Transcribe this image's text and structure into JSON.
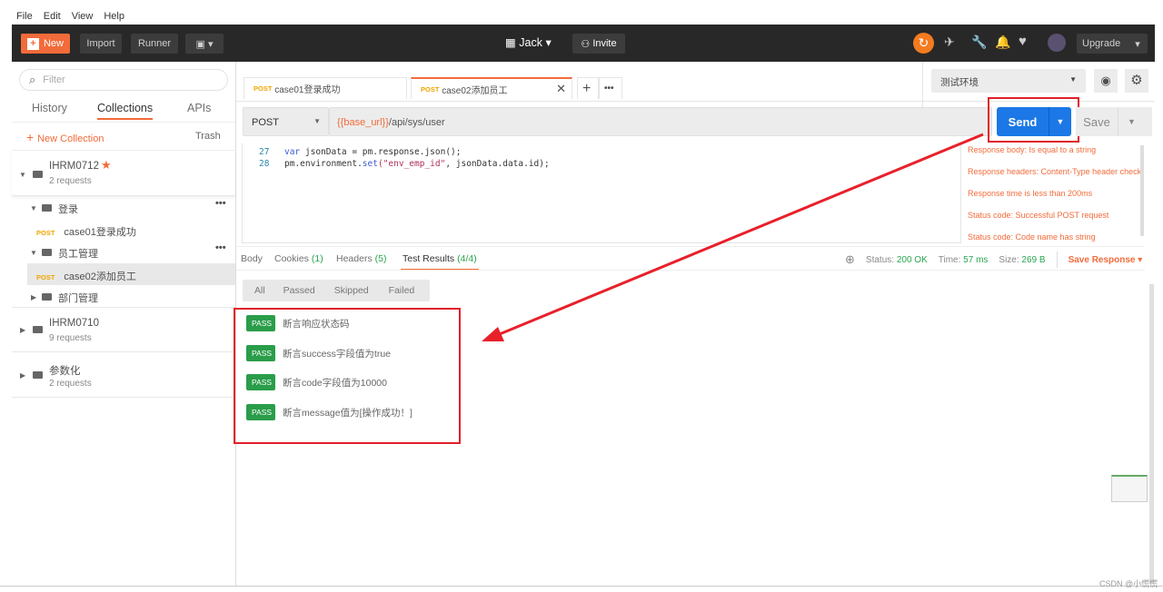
{
  "menu": [
    "File",
    "Edit",
    "View",
    "Help"
  ],
  "topbar": {
    "new": "New",
    "import": "Import",
    "runner": "Runner",
    "workspace": "Jack",
    "invite": "Invite",
    "upgrade": "Upgrade"
  },
  "sidebar": {
    "filter_placeholder": "Filter",
    "tabs": [
      "History",
      "Collections",
      "APIs"
    ],
    "new_collection": "New Collection",
    "trash": "Trash",
    "collections": [
      {
        "name": "IHRM0712",
        "sub": "2 requests",
        "starred": true
      },
      {
        "name": "IHRM0710",
        "sub": "9 requests"
      },
      {
        "name": "参数化",
        "sub": "2 requests"
      }
    ],
    "folders": [
      {
        "name": "登录",
        "requests": [
          {
            "method": "POST",
            "name": "case01登录成功"
          }
        ]
      },
      {
        "name": "员工管理",
        "requests": [
          {
            "method": "POST",
            "name": "case02添加员工"
          }
        ]
      },
      {
        "name": "部门管理"
      }
    ]
  },
  "tabs": [
    {
      "method": "POST",
      "name": "case01登录成功"
    },
    {
      "method": "POST",
      "name": "case02添加员工"
    }
  ],
  "environment": "测试环境",
  "request": {
    "method": "POST",
    "url_var": "{{base_url}}",
    "url_path": "/api/sys/user",
    "send": "Send",
    "save": "Save"
  },
  "code": [
    {
      "line": "27",
      "kw": "var",
      "text": " jsonData = pm.response.json();"
    },
    {
      "line": "28",
      "pre": "pm.environment.",
      "kw": "set",
      "str": "(\"env_emp_id\"",
      "text": ", jsonData.data.id);"
    }
  ],
  "snippets": [
    "Response body: Is equal to a string",
    "Response headers: Content-Type header check",
    "Response time is less than 200ms",
    "Status code: Successful POST request",
    "Status code: Code name has string"
  ],
  "response": {
    "tabs": [
      {
        "label": "Body"
      },
      {
        "label": "Cookies",
        "count": "(1)"
      },
      {
        "label": "Headers",
        "count": "(5)"
      },
      {
        "label": "Test Results",
        "count": "(4/4)"
      }
    ],
    "status_label": "Status:",
    "status": "200 OK",
    "time_label": "Time:",
    "time": "57 ms",
    "size_label": "Size:",
    "size": "269 B",
    "save_response": "Save Response",
    "filters": [
      "All",
      "Passed",
      "Skipped",
      "Failed"
    ],
    "results": [
      {
        "status": "PASS",
        "name": "断言响应状态码"
      },
      {
        "status": "PASS",
        "name": "断言success字段值为true"
      },
      {
        "status": "PASS",
        "name": "断言code字段值为10000"
      },
      {
        "status": "PASS",
        "name": "断言message值为[操作成功！]"
      }
    ]
  },
  "watermark": "CSDN @小慌慌"
}
